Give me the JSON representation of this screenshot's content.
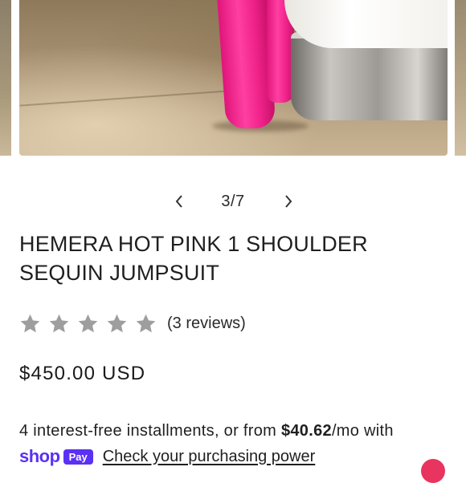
{
  "gallery": {
    "current": "3/7",
    "image_alt": "pink sequin jumpsuit leg on marble floor"
  },
  "product": {
    "title_line1": "HEMERA HOT PINK 1 SHOULDER",
    "title_line2": "SEQUIN JUMPSUIT",
    "rating_stars": 5,
    "rating_value": 0,
    "reviews_label": "(3 reviews)",
    "price": "$450.00 USD"
  },
  "installments": {
    "prefix": "4 interest-free installments, or from ",
    "amount": "$40.62",
    "suffix": "/mo with"
  },
  "shoppay": {
    "brand_shop": "shop",
    "brand_pay": "Pay",
    "link_label": "Check your purchasing power"
  },
  "colors": {
    "star": "#9e9e9e",
    "shoppay": "#5a31f4",
    "accent_pink": "#ff2f96"
  },
  "icons": [
    "chevron-left-icon",
    "chevron-right-icon",
    "star-icon",
    "chat-icon"
  ]
}
